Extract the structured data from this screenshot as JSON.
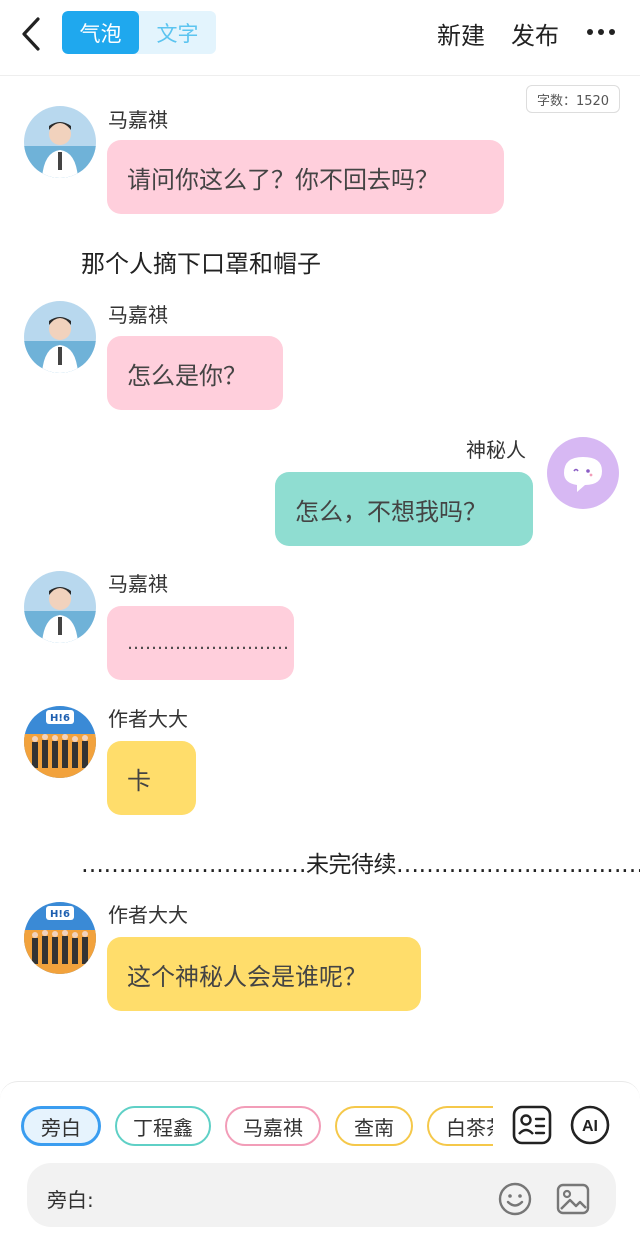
{
  "header": {
    "tabs": [
      {
        "label": "气泡",
        "active": true
      },
      {
        "label": "文字",
        "active": false
      }
    ],
    "new_label": "新建",
    "publish_label": "发布"
  },
  "counter": "字数：1520",
  "messages": [
    {
      "type": "bubble",
      "side": "left",
      "name": "马嘉祺",
      "text": "请问你这么了？你不回去吗？",
      "color": "#ffcfdc"
    },
    {
      "type": "narration",
      "text": "那个人摘下口罩和帽子"
    },
    {
      "type": "bubble",
      "side": "left",
      "name": "马嘉祺",
      "text": "怎么是你？",
      "color": "#ffcfdc"
    },
    {
      "type": "bubble",
      "side": "right",
      "name": "神秘人",
      "text": "怎么，不想我吗？",
      "color": "#8fddd1"
    },
    {
      "type": "bubble",
      "side": "left",
      "name": "马嘉祺",
      "text": "………………………",
      "color": "#ffcfdc"
    },
    {
      "type": "bubble",
      "side": "left",
      "name": "作者大大",
      "text": "卡",
      "color": "#ffdd6b"
    },
    {
      "type": "narration",
      "text": "…………………………未完待续……………………………"
    },
    {
      "type": "bubble",
      "side": "left",
      "name": "作者大大",
      "text": "这个神秘人会是谁呢？",
      "color": "#ffdd6b"
    }
  ],
  "characters": [
    {
      "label": "旁白",
      "color": "#3a9df0",
      "selected": true
    },
    {
      "label": "丁程鑫",
      "color": "#5fd0c6",
      "selected": false
    },
    {
      "label": "马嘉祺",
      "color": "#f29db8",
      "selected": false
    },
    {
      "label": "查南",
      "color": "#f5c84a",
      "selected": false
    },
    {
      "label": "白茶茶",
      "color": "#f5c84a",
      "selected": false
    }
  ],
  "input": {
    "label": "旁白:"
  },
  "icons": [
    "back-icon",
    "more-icon",
    "character-card-icon",
    "ai-icon",
    "emoji-icon",
    "image-icon"
  ],
  "colors": {
    "accent": "#1fa8ee",
    "pink": "#ffcfdc",
    "teal": "#8fddd1",
    "yellow": "#ffdd6b",
    "ghost_avatar": "#d7b8f3"
  }
}
